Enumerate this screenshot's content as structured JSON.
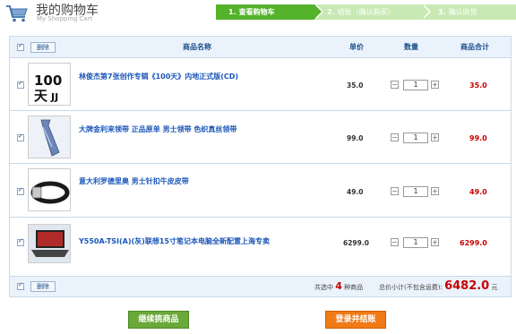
{
  "header": {
    "title": "我的购物车",
    "subtitle": "My Shopping Cart",
    "steps": [
      {
        "num": "1.",
        "label": "查看购物车"
      },
      {
        "num": "2.",
        "label": "结账（确认购买）"
      },
      {
        "num": "3.",
        "label": "确认收货"
      }
    ]
  },
  "table": {
    "delete_label": "删除",
    "columns": {
      "name": "商品名称",
      "price": "单价",
      "qty": "数量",
      "subtotal": "商品合计"
    },
    "rows": [
      {
        "name": "林俊杰第7张创作专辑《100天》内地正式版(CD)",
        "price": "35.0",
        "qty": "1",
        "subtotal": "35.0",
        "thumb": "album-cover-image"
      },
      {
        "name": "大牌金利来领带 正品原单 男士领带 色织真丝领带",
        "price": "99.0",
        "qty": "1",
        "subtotal": "99.0",
        "thumb": "necktie-image"
      },
      {
        "name": "意大利罗德里奥 男士针扣牛皮皮带",
        "price": "49.0",
        "qty": "1",
        "subtotal": "49.0",
        "thumb": "belt-image"
      },
      {
        "name": "Y550A-TSI(A)(灰)联想15寸笔记本电脑全新配置上海专卖",
        "price": "6299.0",
        "qty": "1",
        "subtotal": "6299.0",
        "thumb": "laptop-image"
      }
    ],
    "footer": {
      "selected_prefix": "共选中",
      "selected_count": "4",
      "selected_suffix": "种商品",
      "total_prefix": "总价小计(不包含运费):",
      "total": "6482.0",
      "currency": "元"
    }
  },
  "actions": {
    "continue_label": "继续挑商品",
    "checkout_label": "登录并结账"
  },
  "colors": {
    "accent": "#54b22b",
    "price": "#c80000",
    "link": "#1a56b8",
    "checkout": "#f07a16"
  }
}
